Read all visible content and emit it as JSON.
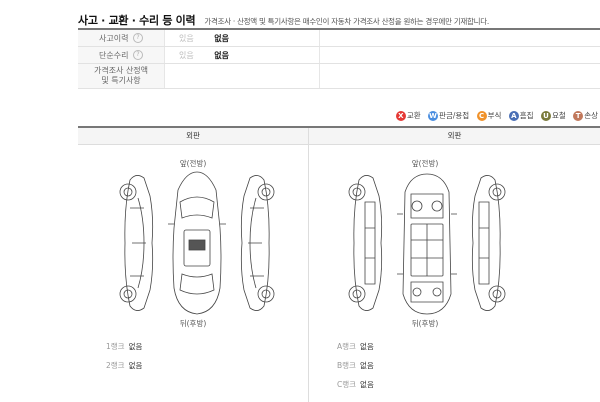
{
  "header": {
    "title": "사고 · 교환 · 수리 등 이력",
    "desc": "가격조사 · 산정액 및 특기사항은 매수인이 자동차 가격조사 산정을 원하는 경우에만 기재합니다."
  },
  "history": {
    "rows": [
      {
        "label": "사고이력",
        "status_label": "있음",
        "answer": "없음"
      },
      {
        "label": "단순수리",
        "status_label": "있음",
        "answer": "없음"
      }
    ],
    "appraisal_label_1": "가격조사 산정액",
    "appraisal_label_2": "및 특기사항",
    "help_icon": "?"
  },
  "legend": [
    {
      "code": "X",
      "label": "교환",
      "color": "#e53935"
    },
    {
      "code": "W",
      "label": "판금/용접",
      "color": "#4a8ee0"
    },
    {
      "code": "C",
      "label": "부식",
      "color": "#f0922b"
    },
    {
      "code": "A",
      "label": "흠집",
      "color": "#4a6fb5"
    },
    {
      "code": "U",
      "label": "요철",
      "color": "#7a7a3a"
    },
    {
      "code": "T",
      "label": "손상",
      "color": "#c1785b"
    }
  ],
  "panels": {
    "left": {
      "header": "외판",
      "front": "앞(전방)",
      "rear": "뒤(후방)",
      "ranks": [
        {
          "label": "1랭크",
          "value": "없음"
        },
        {
          "label": "2랭크",
          "value": "없음"
        }
      ]
    },
    "right": {
      "header": "외판",
      "front": "앞(전방)",
      "rear": "뒤(후방)",
      "ranks": [
        {
          "label": "A랭크",
          "value": "없음"
        },
        {
          "label": "B랭크",
          "value": "없음"
        },
        {
          "label": "C랭크",
          "value": "없음"
        }
      ]
    }
  }
}
